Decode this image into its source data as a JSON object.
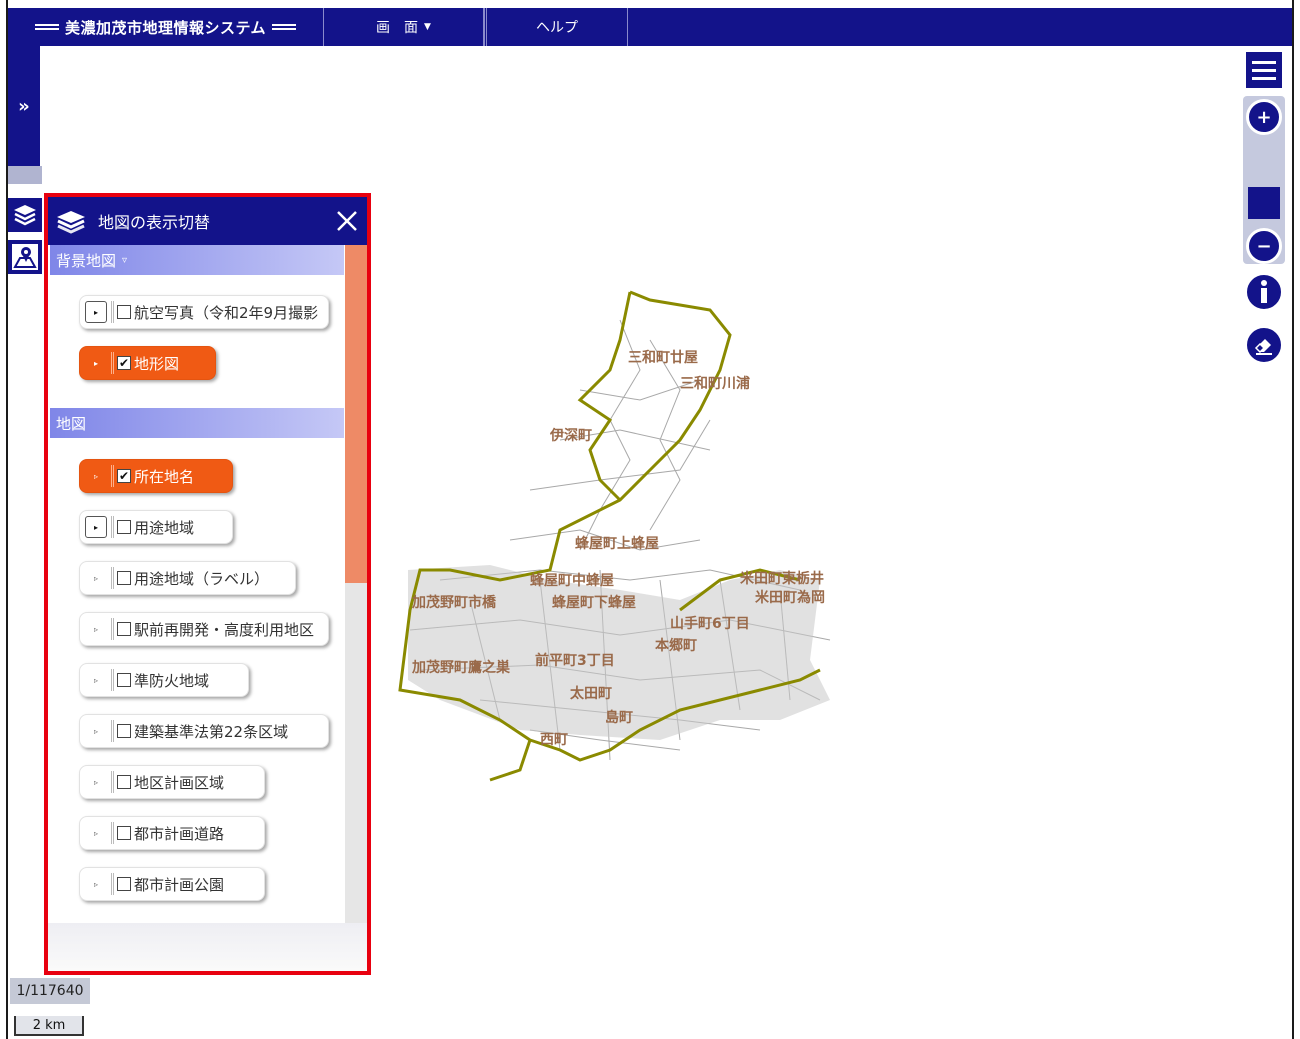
{
  "header": {
    "title": "美濃加茂市地理情報システム",
    "menus": [
      {
        "label": "画　面",
        "has_dropdown": true
      },
      {
        "label": "ヘルプ",
        "has_dropdown": false
      }
    ]
  },
  "side": {
    "expand_icon": "double-chevron-right-icon",
    "layers_icon": "layers-icon",
    "map_pin_icon": "map-pin-icon"
  },
  "tools": {
    "menu_icon": "hamburger-menu-icon",
    "zoom_in": "+",
    "zoom_out": "−",
    "info_icon": "info-icon",
    "eraser_icon": "eraser-icon"
  },
  "panel": {
    "title": "地図の表示切替",
    "sections": [
      {
        "label": "背景地図",
        "indicator": "▿",
        "layers": [
          {
            "label": "航空写真（令和2年9月撮影",
            "checked": false
          },
          {
            "label": "地形図",
            "checked": true
          }
        ]
      },
      {
        "label": "地図",
        "layers": [
          {
            "label": "所在地名",
            "checked": true
          },
          {
            "label": "用途地域",
            "checked": false
          },
          {
            "label": "用途地域（ラベル）",
            "checked": false
          },
          {
            "label": "駅前再開発・高度利用地区",
            "checked": false
          },
          {
            "label": "準防火地域",
            "checked": false
          },
          {
            "label": "建築基準法第22条区域",
            "checked": false
          },
          {
            "label": "地区計画区域",
            "checked": false
          },
          {
            "label": "都市計画道路",
            "checked": false
          },
          {
            "label": "都市計画公園",
            "checked": false
          }
        ]
      }
    ]
  },
  "map": {
    "place_labels": [
      "三和町廿屋",
      "三和町川浦",
      "伊深町",
      "蜂屋町上蜂屋",
      "蜂屋町中蜂屋",
      "米田町東栃井",
      "米田町為岡",
      "加茂野町市橋",
      "蜂屋町下蜂屋",
      "山手町6丁目",
      "加茂野町鷹之巣",
      "前平町3丁目",
      "本郷町",
      "太田町",
      "島町",
      "西町"
    ],
    "boundary_color": "#8a8a00",
    "road_color": "#9a9a9a"
  },
  "scale": {
    "ratio": "1/117640",
    "bar": "2 km"
  }
}
